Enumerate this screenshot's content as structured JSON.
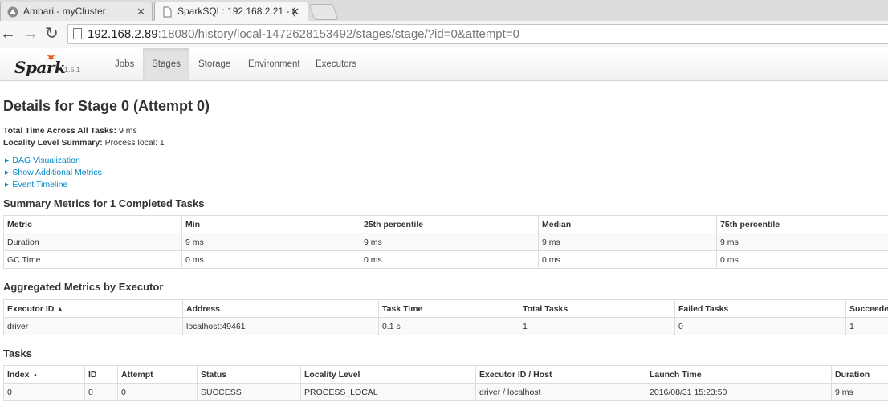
{
  "browser": {
    "tabs": [
      {
        "title": "Ambari - myCluster",
        "active": false
      },
      {
        "title": "SparkSQL::192.168.2.21 - (",
        "active": true
      }
    ],
    "url_host": "192.168.2.89",
    "url_rest": ":18080/history/local-1472628153492/stages/stage/?id=0&attempt=0"
  },
  "navbar": {
    "brand": "Spark",
    "version": "1.6.1",
    "links": [
      "Jobs",
      "Stages",
      "Storage",
      "Environment",
      "Executors"
    ],
    "active": "Stages"
  },
  "page": {
    "title": "Details for Stage 0 (Attempt 0)",
    "total_time_label": "Total Time Across All Tasks:",
    "total_time_value": "9 ms",
    "locality_label": "Locality Level Summary:",
    "locality_value": "Process local: 1",
    "expanders": [
      "DAG Visualization",
      "Show Additional Metrics",
      "Event Timeline"
    ]
  },
  "summary": {
    "heading": "Summary Metrics for 1 Completed Tasks",
    "columns": [
      "Metric",
      "Min",
      "25th percentile",
      "Median",
      "75th percentile"
    ],
    "rows": [
      [
        "Duration",
        "9 ms",
        "9 ms",
        "9 ms",
        "9 ms"
      ],
      [
        "GC Time",
        "0 ms",
        "0 ms",
        "0 ms",
        "0 ms"
      ]
    ]
  },
  "executors": {
    "heading": "Aggregated Metrics by Executor",
    "columns": [
      "Executor ID",
      "Address",
      "Task Time",
      "Total Tasks",
      "Failed Tasks",
      "Succeeded"
    ],
    "rows": [
      [
        "driver",
        "localhost:49461",
        "0.1 s",
        "1",
        "0",
        "1"
      ]
    ]
  },
  "tasks": {
    "heading": "Tasks",
    "columns": [
      "Index",
      "ID",
      "Attempt",
      "Status",
      "Locality Level",
      "Executor ID / Host",
      "Launch Time",
      "Duration"
    ],
    "rows": [
      [
        "0",
        "0",
        "0",
        "SUCCESS",
        "PROCESS_LOCAL",
        "driver / localhost",
        "2016/08/31 15:23:50",
        "9 ms"
      ]
    ]
  },
  "colors": {
    "link": "#0088cc",
    "spark_orange": "#e25a1c"
  }
}
